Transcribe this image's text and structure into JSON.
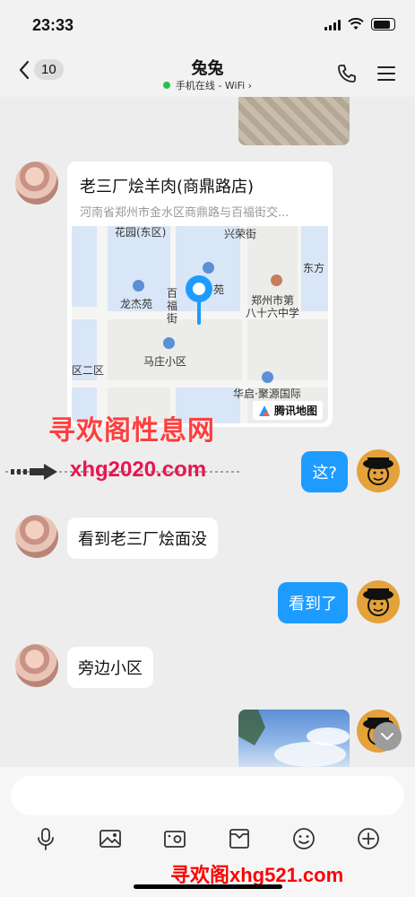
{
  "status_bar": {
    "time": "23:33"
  },
  "nav": {
    "back_count": "10",
    "title": "兔兔",
    "subtitle": "手机在线 - WiFi",
    "subtitle_chevron": "›"
  },
  "messages": [
    {
      "type": "image",
      "side": "incoming-cut",
      "description": "photo"
    },
    {
      "type": "location",
      "side": "left",
      "title": "老三厂烩羊肉(商鼎路店)",
      "address": "河南省郑州市金水区商鼎路与百福街交..."
    },
    {
      "type": "text",
      "side": "right",
      "text": "这?"
    },
    {
      "type": "text",
      "side": "left",
      "text": "看到老三厂烩面没"
    },
    {
      "type": "text",
      "side": "right",
      "text": "看到了"
    },
    {
      "type": "text",
      "side": "left",
      "text": "旁边小区"
    },
    {
      "type": "image",
      "side": "right",
      "description": "sky photo"
    }
  ],
  "map": {
    "labels": [
      "花园(东区)",
      "兴荣街",
      "东方",
      "龙杰苑",
      "百",
      "福",
      "街",
      "苑",
      "郑州市第",
      "八十六中学",
      "马庄小区",
      "区二区",
      "华启·聚源国际"
    ],
    "provider": "腾讯地图"
  },
  "watermarks": {
    "top": "寻欢阁性息网",
    "middle": "xhg2020.com",
    "bottom": "寻欢阁xhg521.com"
  },
  "composer": {
    "placeholder": "",
    "tools": [
      "microphone-icon",
      "image-icon",
      "camera-icon",
      "folder-icon",
      "emoji-icon",
      "plus-icon"
    ]
  },
  "colors": {
    "accent": "#1e9bff",
    "online": "#27c24c",
    "background": "#ededed"
  }
}
